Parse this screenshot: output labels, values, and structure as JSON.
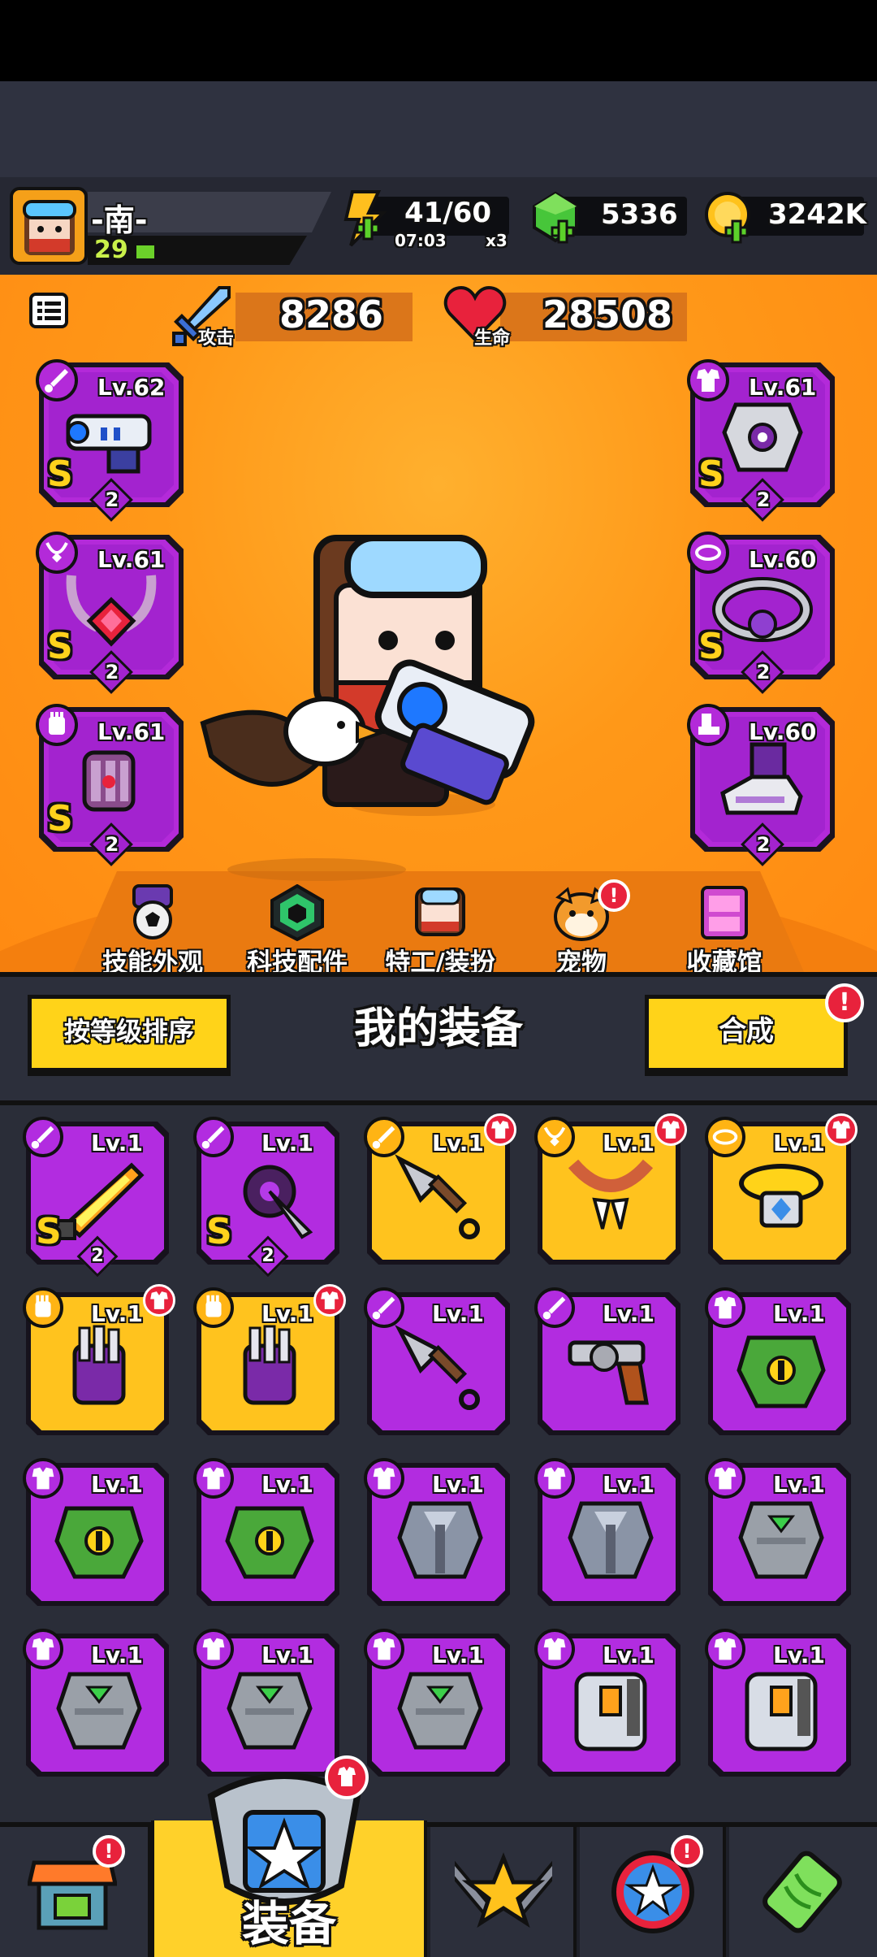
{
  "player": {
    "name": "-南-",
    "level": "29"
  },
  "resources": {
    "energy": {
      "value": "41/60",
      "timer": "07:03",
      "multiplier": "x3"
    },
    "gems": {
      "value": "5336"
    },
    "coins": {
      "value": "3242K"
    }
  },
  "stats": {
    "attack": {
      "label": "攻击",
      "value": "8286"
    },
    "hp": {
      "label": "生命",
      "value": "28508"
    }
  },
  "equipped": {
    "left": [
      {
        "level": "Lv.62",
        "rank": "S",
        "stars": "2",
        "icon": "blaster-gun"
      },
      {
        "level": "Lv.61",
        "rank": "S",
        "stars": "2",
        "icon": "chain-necklace"
      },
      {
        "level": "Lv.61",
        "rank": "S",
        "stars": "2",
        "icon": "gauntlet"
      }
    ],
    "right": [
      {
        "level": "Lv.61",
        "rank": "S",
        "stars": "2",
        "icon": "armor"
      },
      {
        "level": "Lv.60",
        "rank": "S",
        "stars": "2",
        "icon": "belt"
      },
      {
        "level": "Lv.60",
        "rank": "",
        "stars": "2",
        "icon": "boots"
      }
    ]
  },
  "feature_nav": [
    {
      "label": "技能外观",
      "icon": "skill-skin-icon"
    },
    {
      "label": "科技配件",
      "icon": "tech-part-icon"
    },
    {
      "label": "特工/装扮",
      "icon": "agent-icon"
    },
    {
      "label": "宠物",
      "icon": "pet-icon"
    },
    {
      "label": "收藏馆",
      "icon": "collection-icon"
    }
  ],
  "controls": {
    "sort_label": "按等级排序",
    "title": "我的装备",
    "merge_label": "合成",
    "badge": "!"
  },
  "inventory": [
    {
      "level": "Lv.1",
      "rarity": "purple",
      "rank": "S",
      "stars": "2",
      "icon": "flame-sword"
    },
    {
      "level": "Lv.1",
      "rarity": "purple",
      "rank": "S",
      "stars": "2",
      "icon": "spike-drill"
    },
    {
      "level": "Lv.1",
      "rarity": "gold",
      "rank": "",
      "stars": "",
      "icon": "kunai"
    },
    {
      "level": "Lv.1",
      "rarity": "gold",
      "rank": "",
      "stars": "",
      "icon": "fang-necklace"
    },
    {
      "level": "Lv.1",
      "rarity": "gold",
      "rank": "",
      "stars": "",
      "icon": "gem-belt"
    },
    {
      "level": "Lv.1",
      "rarity": "gold",
      "rank": "",
      "stars": "",
      "icon": "claw-glove"
    },
    {
      "level": "Lv.1",
      "rarity": "gold",
      "rank": "",
      "stars": "",
      "icon": "claw-glove"
    },
    {
      "level": "Lv.1",
      "rarity": "purple",
      "rank": "",
      "stars": "",
      "icon": "kunai"
    },
    {
      "level": "Lv.1",
      "rarity": "purple",
      "rank": "",
      "stars": "",
      "icon": "revolver"
    },
    {
      "level": "Lv.1",
      "rarity": "purple",
      "rank": "",
      "stars": "",
      "icon": "dragon-vest"
    },
    {
      "level": "Lv.1",
      "rarity": "purple",
      "rank": "",
      "stars": "",
      "icon": "dragon-vest"
    },
    {
      "level": "Lv.1",
      "rarity": "purple",
      "rank": "",
      "stars": "",
      "icon": "dragon-vest"
    },
    {
      "level": "Lv.1",
      "rarity": "purple",
      "rank": "",
      "stars": "",
      "icon": "steel-armor"
    },
    {
      "level": "Lv.1",
      "rarity": "purple",
      "rank": "",
      "stars": "",
      "icon": "steel-armor"
    },
    {
      "level": "Lv.1",
      "rarity": "purple",
      "rank": "",
      "stars": "",
      "icon": "stone-vest"
    },
    {
      "level": "Lv.1",
      "rarity": "purple",
      "rank": "",
      "stars": "",
      "icon": "stone-vest"
    },
    {
      "level": "Lv.1",
      "rarity": "purple",
      "rank": "",
      "stars": "",
      "icon": "stone-vest"
    },
    {
      "level": "Lv.1",
      "rarity": "purple",
      "rank": "",
      "stars": "",
      "icon": "stone-vest"
    },
    {
      "level": "Lv.1",
      "rarity": "purple",
      "rank": "",
      "stars": "",
      "icon": "mech-armor"
    },
    {
      "level": "Lv.1",
      "rarity": "purple",
      "rank": "",
      "stars": "",
      "icon": "mech-armor"
    }
  ],
  "bottom_nav": [
    {
      "label": "",
      "icon": "shop-icon"
    },
    {
      "label": "装备",
      "icon": "equipment-icon"
    },
    {
      "label": "",
      "icon": "battle-icon"
    },
    {
      "label": "",
      "icon": "talent-icon"
    },
    {
      "label": "",
      "icon": "evolve-icon"
    }
  ],
  "colors": {
    "accent": "#ffd319",
    "purple_rarity": "#b22ce0",
    "gold_rarity": "#ffc31e",
    "badge": "#e8223c",
    "bg_orange": "#ff9818"
  }
}
